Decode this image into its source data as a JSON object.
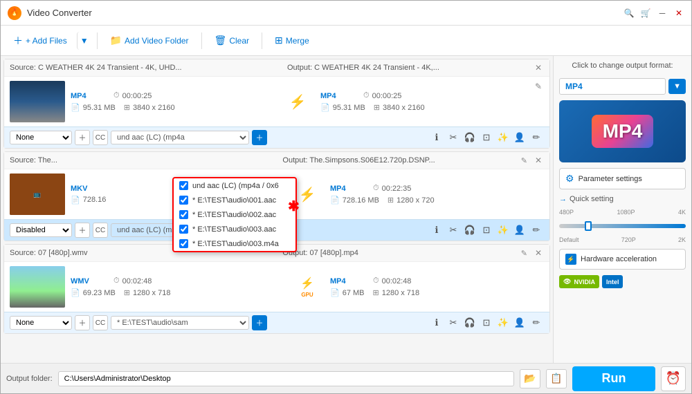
{
  "app": {
    "title": "Video Converter",
    "icon": "🔥"
  },
  "toolbar": {
    "add_files": "+ Add Files",
    "add_folder": "Add Video Folder",
    "clear": "Clear",
    "merge": "Merge"
  },
  "files": [
    {
      "id": 1,
      "source_label": "Source: C  WEATHER  4K 24  Transient - 4K, UHD...",
      "output_label": "Output: C  WEATHER  4K 24  Transient - 4K,...",
      "input_format": "MP4",
      "input_duration": "00:00:25",
      "input_size": "95.31 MB",
      "input_resolution": "3840 x 2160",
      "output_format": "MP4",
      "output_duration": "00:00:25",
      "output_size": "95.31 MB",
      "output_resolution": "3840 x 2160",
      "subtitle": "None",
      "audio": "und aac (LC) (mp4a",
      "arrow_type": "normal"
    },
    {
      "id": 2,
      "source_label": "Source: The...",
      "output_label": "Output: The.Simpsons.S06E12.720p.DSNP...",
      "input_format": "MKV",
      "input_duration": "",
      "input_size": "728.16",
      "input_resolution": "",
      "output_format": "MP4",
      "output_duration": "00:22:35",
      "output_size": "728.16 MB",
      "output_resolution": "1280 x 720",
      "subtitle": "Disabled",
      "audio": "und aac (LC) (mp4a",
      "arrow_type": "normal"
    },
    {
      "id": 3,
      "source_label": "Source: 07 [480p].wmv",
      "output_label": "Output: 07 [480p].mp4",
      "input_format": "WMV",
      "input_duration": "00:02:48",
      "input_size": "69.23 MB",
      "input_resolution": "1280 x 718",
      "output_format": "MP4",
      "output_duration": "00:02:48",
      "output_size": "67 MB",
      "output_resolution": "1280 x 718",
      "subtitle": "None",
      "audio": "* E:\\TEST\\audio\\sam",
      "arrow_type": "gpu"
    }
  ],
  "dropdown": {
    "title": "und aac (LC) (mp4a",
    "items": [
      {
        "label": "und aac (LC) (mp4a / 0x6",
        "checked": true
      },
      {
        "label": "* E:\\TEST\\audio\\001.aac",
        "checked": true
      },
      {
        "label": "* E:\\TEST\\audio\\002.aac",
        "checked": true
      },
      {
        "label": "* E:\\TEST\\audio\\003.aac",
        "checked": true
      },
      {
        "label": "* E:\\TEST\\audio\\003.m4a",
        "checked": true
      }
    ]
  },
  "right_panel": {
    "format_label": "Click to change output format:",
    "format": "MP4",
    "mp4_text": "MP4",
    "param_settings": "Parameter settings",
    "quick_setting": "Quick setting",
    "quality_labels": [
      "Default",
      "720P",
      "2K"
    ],
    "quality_options": [
      "480P",
      "1080P",
      "4K"
    ],
    "hw_label": "Hardware acceleration",
    "nvidia_label": "NVIDIA",
    "intel_label": "Intel"
  },
  "bottom": {
    "output_label": "Output folder:",
    "output_path": "C:\\Users\\Administrator\\Desktop",
    "run_label": "Run"
  }
}
